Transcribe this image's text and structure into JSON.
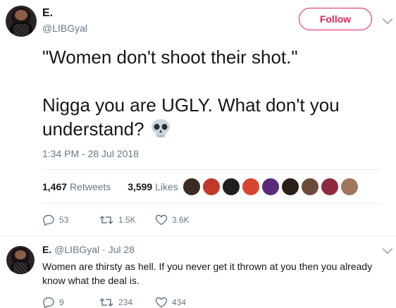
{
  "tweet": {
    "display_name": "E.",
    "handle": "@LIBGyal",
    "follow_label": "Follow",
    "text": "\"Women don't shoot their shot.\"\n\nNigga you are UGLY. What don't you understand?",
    "emoji": "skull-emoji",
    "timestamp": "1:34 PM - 28 Jul 2018",
    "retweets_count": "1,467",
    "retweets_label": "Retweets",
    "likes_count": "3,599",
    "likes_label": "Likes",
    "actions": {
      "replies": "53",
      "retweets": "1.5K",
      "likes": "3.6K"
    }
  },
  "reply": {
    "display_name": "E.",
    "handle": "@LIBGyal",
    "separator": "·",
    "date": "Jul 28",
    "text": "Women are thirsty as hell. If you never get it thrown at you then you already know what the deal is.",
    "actions": {
      "replies": "9",
      "retweets": "234",
      "likes": "434"
    }
  },
  "colors": {
    "accent": "#e0245e",
    "muted": "#657786",
    "text": "#14171a",
    "divider": "#e6ecf0"
  },
  "likers": [
    "liker-1",
    "liker-2",
    "liker-3",
    "liker-4",
    "liker-5",
    "liker-6",
    "liker-7",
    "liker-8",
    "liker-9"
  ]
}
